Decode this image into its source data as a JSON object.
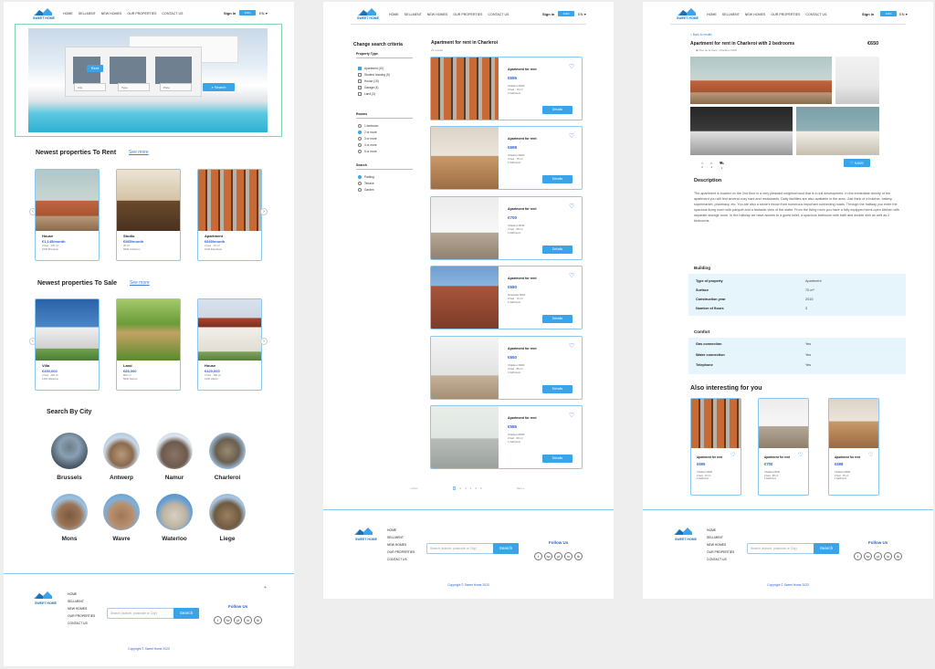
{
  "brand": {
    "name": "SWEET HOME",
    "accent": "#3ba4e8",
    "price_color": "#2f62d6"
  },
  "nav": {
    "links": [
      "HOME",
      "SELLMENT",
      "NEW HOMES",
      "OUR PROPERTIES",
      "CONTACT US"
    ],
    "sign_in": "Sign in",
    "join": "JOIN",
    "lang": "EN"
  },
  "home": {
    "hero": {
      "tab": "Rent",
      "fields": [
        "City",
        "Type",
        "Price"
      ],
      "search": "Search"
    },
    "rent": {
      "title": "Newest properties To Rent",
      "see_more": "See more",
      "cards": [
        {
          "type": "House",
          "price": "€1,145/month",
          "line1": "3 bed · 140 m²",
          "line2": "1000 Brussels"
        },
        {
          "type": "Studio",
          "price": "€565/month",
          "line1": "35 m²",
          "line2": "6000 Charleroi"
        },
        {
          "type": "Apartment",
          "price": "€665/month",
          "line1": "2 bed · 70 m²",
          "line2": "1040 Etterbeek"
        }
      ]
    },
    "sale": {
      "title": "Newest properties To Sale",
      "see_more": "See more",
      "cards": [
        {
          "type": "Villa",
          "price": "€490,000",
          "line1": "4 bed · 260 m²",
          "line2": "1410 Waterloo"
        },
        {
          "type": "Land",
          "price": "€85,000",
          "line1": "800 m²",
          "line2": "5000 Namur"
        },
        {
          "type": "House",
          "price": "€420,000",
          "line1": "3 bed · 180 m²",
          "line2": "1300 Wavre"
        }
      ]
    },
    "cities_title": "Search By City",
    "cities": [
      "Brussels",
      "Antwerp",
      "Namur",
      "Charleroi",
      "Mons",
      "Wavre",
      "Waterloo",
      "Liege"
    ]
  },
  "footer": {
    "links": [
      "HOME",
      "SELLMENT",
      "NEW HOMES",
      "OUR PROPERTIES",
      "CONTACT US"
    ],
    "search_placeholder": "Search (suburb, postcode or City)",
    "search": "Search",
    "follow": "Follow Us",
    "social": [
      "f",
      "tw",
      "yt",
      "in",
      "tk"
    ],
    "copyright": "Copyright © Sweet Home 2023"
  },
  "search_page": {
    "criteria": "Change search criteria",
    "groups": [
      {
        "title": "Property Type",
        "kind": "checkbox",
        "options": [
          {
            "label": "Apartment (10)",
            "on": true
          },
          {
            "label": "Student housing (5)",
            "on": false
          },
          {
            "label": "House (15)",
            "on": false
          },
          {
            "label": "Garage (4)",
            "on": false
          },
          {
            "label": "Land (3)",
            "on": false
          }
        ]
      },
      {
        "title": "Rooms",
        "kind": "radio",
        "options": [
          {
            "label": "1 bedroom",
            "on": false
          },
          {
            "label": "2 or more",
            "on": true
          },
          {
            "label": "3 or more",
            "on": false
          },
          {
            "label": "4 or more",
            "on": false
          },
          {
            "label": "5 or more",
            "on": false
          }
        ]
      },
      {
        "title": "Search",
        "kind": "radio",
        "options": [
          {
            "label": "Parking",
            "on": true
          },
          {
            "label": "Terrace",
            "on": false
          },
          {
            "label": "Garden",
            "on": false
          }
        ]
      }
    ],
    "heading": "Apartment for rent in Charleroi",
    "count": "24 results",
    "listings": [
      {
        "title": "Apartment for rent",
        "price": "€695",
        "city": "Charleroi 6000",
        "line1": "2 bed · 70 m²",
        "line2": "1 bathroom",
        "btn": "Details"
      },
      {
        "title": "Apartment for rent",
        "price": "€698",
        "city": "Charleroi 6000",
        "line1": "2 bed · 75 m²",
        "line2": "1 bathroom",
        "btn": "Details"
      },
      {
        "title": "Apartment for rent",
        "price": "€700",
        "city": "Charleroi 6040",
        "line1": "2 bed · 68 m²",
        "line2": "1 bathroom",
        "btn": "Details"
      },
      {
        "title": "Apartment for rent",
        "price": "€680",
        "city": "Gosselies 6041",
        "line1": "2 bed · 72 m²",
        "line2": "1 bathroom",
        "btn": "Details"
      },
      {
        "title": "Apartment for rent",
        "price": "€650",
        "city": "Charleroi 6000",
        "line1": "2 bed · 65 m²",
        "line2": "1 bathroom",
        "btn": "Details"
      },
      {
        "title": "Apartment for rent",
        "price": "€585",
        "city": "Charleroi 6000",
        "line1": "2 bed · 60 m²",
        "line2": "1 bathroom",
        "btn": "Details"
      }
    ],
    "pager": {
      "prev": "« Prev",
      "pages": [
        "1",
        "2",
        "3",
        "4",
        "5",
        "6"
      ],
      "next": "Next »"
    }
  },
  "detail_page": {
    "back": "< Back to results",
    "title": "Apartment for rent in Charleroi with 2 bedrooms",
    "price": "€650",
    "address": "Rue de la Gare, Charleroi 6000",
    "amenities": [
      "2",
      "1",
      "1"
    ],
    "save": "SAVE",
    "description_title": "Description",
    "description": "The apartment is located on the 2nd floor in a very pleasant neighborhood that is in full development. In the immediate vicinity of the apartment you will find several cozy bars and restaurants. Daily facilities are also available in the area. Just think of a butcher, bakery, supermarket, pharmacy, etc. You are also a stone's throw from numerous important connecting roads. Through the hallway you enter the spacious living room with parquet and a fantastic view of the water. From the living room you have a fully equipped semi-open kitchen with separate storage room. In the hallway we have access to a guest toilet, a spacious bathroom with bath and double sink as well as 2 bedrooms.",
    "building_title": "Building",
    "building": [
      {
        "k": "Type of property",
        "v": "Apartment"
      },
      {
        "k": "Surface",
        "v": "70 m²"
      },
      {
        "k": "Construction year",
        "v": "2015"
      },
      {
        "k": "Number of floors",
        "v": "3"
      }
    ],
    "comfort_title": "Comfort",
    "comfort": [
      {
        "k": "Gas connection",
        "v": "Yes"
      },
      {
        "k": "Water connection",
        "v": "Yes"
      },
      {
        "k": "Telephone",
        "v": "Yes"
      }
    ],
    "also_title": "Also interesting for you",
    "also": [
      {
        "title": "Apartment for rent",
        "price": "€695",
        "city": "Charleroi 6000",
        "line1": "2 bed · 70 m²",
        "line2": "1 bathroom"
      },
      {
        "title": "Apartment for rent",
        "price": "€700",
        "city": "Charleroi 6040",
        "line1": "2 bed · 68 m²",
        "line2": "1 bathroom"
      },
      {
        "title": "Apartment for rent",
        "price": "€698",
        "city": "Charleroi 6000",
        "line1": "2 bed · 75 m²",
        "line2": "1 bathroom"
      }
    ]
  }
}
